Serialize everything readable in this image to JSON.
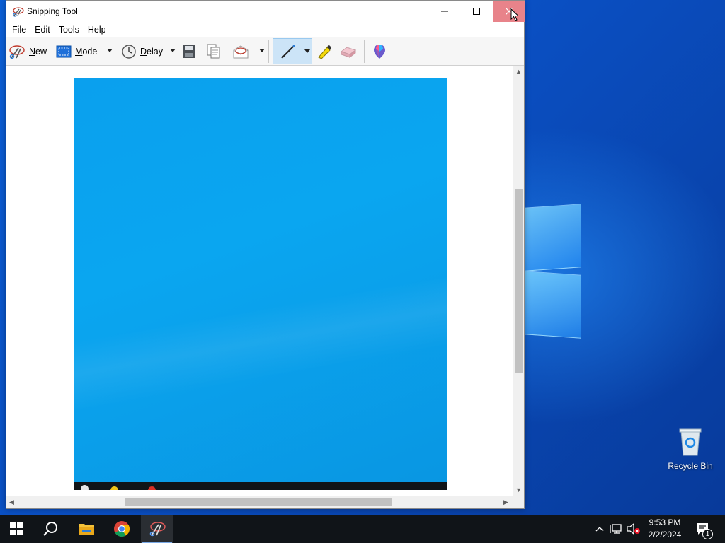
{
  "window": {
    "title": "Snipping Tool",
    "menu": [
      "File",
      "Edit",
      "Tools",
      "Help"
    ],
    "toolbar": {
      "new_label": "New",
      "mode_label": "Mode",
      "delay_label": "Delay"
    }
  },
  "desktop": {
    "recycle_bin_label": "Recycle Bin"
  },
  "taskbar": {
    "time": "9:53 PM",
    "date": "2/2/2024",
    "notification_count": "1",
    "apps": [
      "start-icon",
      "search-icon",
      "file-explorer-icon",
      "chrome-icon",
      "snipping-tool-icon"
    ]
  },
  "colors": {
    "close_hover": "#e8838a",
    "selected_tool": "#cce4f7",
    "taskbar": "#101418",
    "wallpaper": "#0a4fc2"
  }
}
